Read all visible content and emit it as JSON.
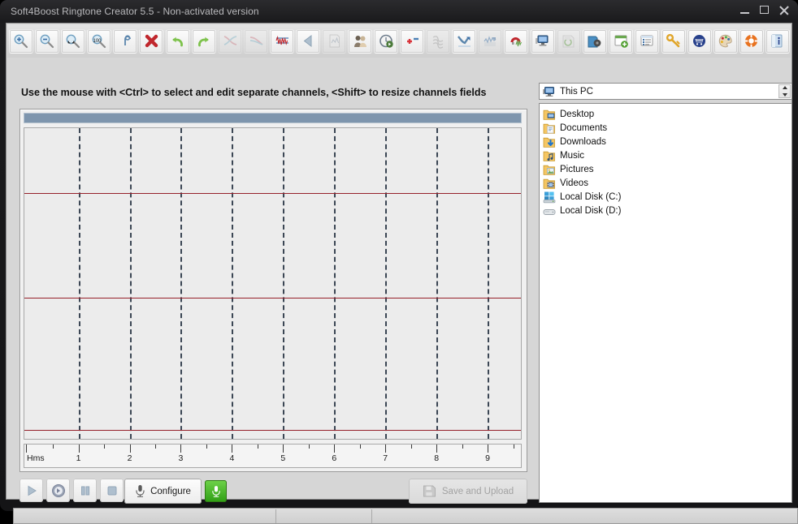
{
  "window": {
    "title": "Soft4Boost Ringtone Creator 5.5 - Non-activated version",
    "minimize_label": "Minimize",
    "maximize_label": "Maximize",
    "close_label": "Close"
  },
  "toolbar": {
    "groups": [
      {
        "name": "zoom",
        "buttons": [
          {
            "name": "zoom-in-button",
            "icon": "magnifier-plus-icon",
            "label": "Zoom In",
            "enabled": true
          },
          {
            "name": "zoom-out-button",
            "icon": "magnifier-minus-icon",
            "label": "Zoom Out",
            "enabled": true
          },
          {
            "name": "zoom-selection-button",
            "icon": "magnifier-selection-icon",
            "label": "Zoom to Selection",
            "enabled": true
          },
          {
            "name": "zoom-100-button",
            "icon": "magnifier-100-icon",
            "label": "Zoom 100%",
            "enabled": true
          }
        ]
      },
      {
        "name": "edit",
        "buttons": [
          {
            "name": "trim-button",
            "icon": "hook-icon",
            "label": "Trim",
            "enabled": true
          },
          {
            "name": "delete-button",
            "icon": "red-cross-icon",
            "label": "Delete",
            "enabled": true
          }
        ]
      },
      {
        "name": "history",
        "buttons": [
          {
            "name": "undo-button",
            "icon": "undo-arrow-icon",
            "label": "Undo",
            "enabled": true
          },
          {
            "name": "redo-button",
            "icon": "redo-arrow-icon",
            "label": "Redo",
            "enabled": true
          }
        ]
      },
      {
        "name": "effects",
        "buttons": [
          {
            "name": "fade-in-button",
            "icon": "fade-in-curve-icon",
            "label": "Fade In",
            "enabled": false
          },
          {
            "name": "fade-out-button",
            "icon": "fade-out-curve-icon",
            "label": "Fade Out",
            "enabled": false
          },
          {
            "name": "normalize-button",
            "icon": "waveform-lines-icon",
            "label": "Normalize",
            "enabled": true
          },
          {
            "name": "reverse-button",
            "icon": "left-triangle-icon",
            "label": "Reverse",
            "enabled": true
          },
          {
            "name": "notes-button",
            "icon": "note-page-icon",
            "label": "Notes",
            "enabled": false
          },
          {
            "name": "voice-button",
            "icon": "two-people-icon",
            "label": "Voice",
            "enabled": true
          },
          {
            "name": "preview-button",
            "icon": "clock-play-icon",
            "label": "Preview",
            "enabled": true
          },
          {
            "name": "amplify-button",
            "icon": "plus-minus-icon",
            "label": "Amplify",
            "enabled": true
          },
          {
            "name": "echo-button",
            "icon": "spring-coil-icon",
            "label": "Echo",
            "enabled": false
          },
          {
            "name": "compress-button",
            "icon": "blue-arrow-chart-icon",
            "label": "Compressor",
            "enabled": true
          },
          {
            "name": "equalizer-button",
            "icon": "equalizer-chart-icon",
            "label": "Equalizer",
            "enabled": false
          },
          {
            "name": "magnet-button",
            "icon": "magnet-waveform-icon",
            "label": "Snap",
            "enabled": true
          }
        ]
      },
      {
        "name": "sources",
        "buttons": [
          {
            "name": "this-pc-button",
            "icon": "monitor-icon",
            "label": "This PC",
            "enabled": true
          },
          {
            "name": "cd-drive-button",
            "icon": "disc-drive-icon",
            "label": "CD Drive",
            "enabled": false
          },
          {
            "name": "import-device-button",
            "icon": "device-import-icon",
            "label": "Import Device",
            "enabled": true
          }
        ]
      },
      {
        "name": "views",
        "buttons": [
          {
            "name": "add-window-button",
            "icon": "window-plus-icon",
            "label": "Add",
            "enabled": true
          },
          {
            "name": "list-view-button",
            "icon": "list-view-icon",
            "label": "List View",
            "enabled": true
          }
        ]
      },
      {
        "name": "app",
        "buttons": [
          {
            "name": "activation-key-button",
            "icon": "key-icon",
            "label": "Activation Key",
            "enabled": true
          },
          {
            "name": "buy-button",
            "icon": "shopping-cart-icon",
            "label": "Buy",
            "enabled": true
          },
          {
            "name": "skins-button",
            "icon": "palette-icon",
            "label": "Skins",
            "enabled": true
          },
          {
            "name": "support-button",
            "icon": "lifering-icon",
            "label": "Support",
            "enabled": true
          },
          {
            "name": "about-button",
            "icon": "info-book-icon",
            "label": "About",
            "enabled": true
          }
        ]
      }
    ]
  },
  "hint": {
    "text": "Use the mouse with <Ctrl> to select and edit separate channels, <Shift> to resize channels fields"
  },
  "waveform": {
    "header_color": "#7e95ad",
    "zero_line_color": "#96202a",
    "grid_color": "#1d2a3a",
    "background_color": "#ececec",
    "channel_zero_lines_pct": [
      21,
      54.5,
      97
    ],
    "grid_positions_pct": [
      10.9,
      21.2,
      31.5,
      41.8,
      52.1,
      62.4,
      72.7,
      83.0,
      93.3
    ]
  },
  "ruler": {
    "unit_label": "Hms",
    "major_ticks": [
      "1",
      "2",
      "3",
      "4",
      "5",
      "6",
      "7",
      "8",
      "9"
    ],
    "major_positions_pct": [
      10.9,
      21.2,
      31.5,
      41.8,
      52.1,
      62.4,
      72.7,
      83.0,
      93.3
    ]
  },
  "transport": {
    "buttons": [
      {
        "name": "play-button",
        "icon": "play-icon",
        "label": "Play",
        "enabled": false
      },
      {
        "name": "play-selection-button",
        "icon": "play-circle-icon",
        "label": "Play Selection",
        "enabled": false
      },
      {
        "name": "pause-button",
        "icon": "pause-icon",
        "label": "Pause",
        "enabled": false
      },
      {
        "name": "stop-button",
        "icon": "stop-icon",
        "label": "Stop",
        "enabled": false
      }
    ],
    "configure_label": "Configure",
    "configure_icon": "microphone-icon",
    "record_label": "Record",
    "record_icon": "microphone-icon",
    "record_color": "#3ba81a",
    "save_label": "Save and Upload",
    "save_icon": "floppy-disk-icon",
    "save_enabled": false
  },
  "browser": {
    "path_value": "This PC",
    "path_icon": "monitor-icon",
    "spinner_up_label": "Up",
    "spinner_down_label": "Down",
    "tree_items": [
      {
        "label": "Desktop",
        "icon": "folder-desktop-icon"
      },
      {
        "label": "Documents",
        "icon": "folder-documents-icon"
      },
      {
        "label": "Downloads",
        "icon": "folder-downloads-icon"
      },
      {
        "label": "Music",
        "icon": "folder-music-icon"
      },
      {
        "label": "Pictures",
        "icon": "folder-pictures-icon"
      },
      {
        "label": "Videos",
        "icon": "folder-videos-icon"
      },
      {
        "label": "Local Disk (C:)",
        "icon": "system-drive-icon"
      },
      {
        "label": "Local Disk (D:)",
        "icon": "drive-icon"
      }
    ]
  },
  "statusbar": {
    "panel_1_text": "",
    "panel_2_text": "",
    "panel_3_text": ""
  }
}
